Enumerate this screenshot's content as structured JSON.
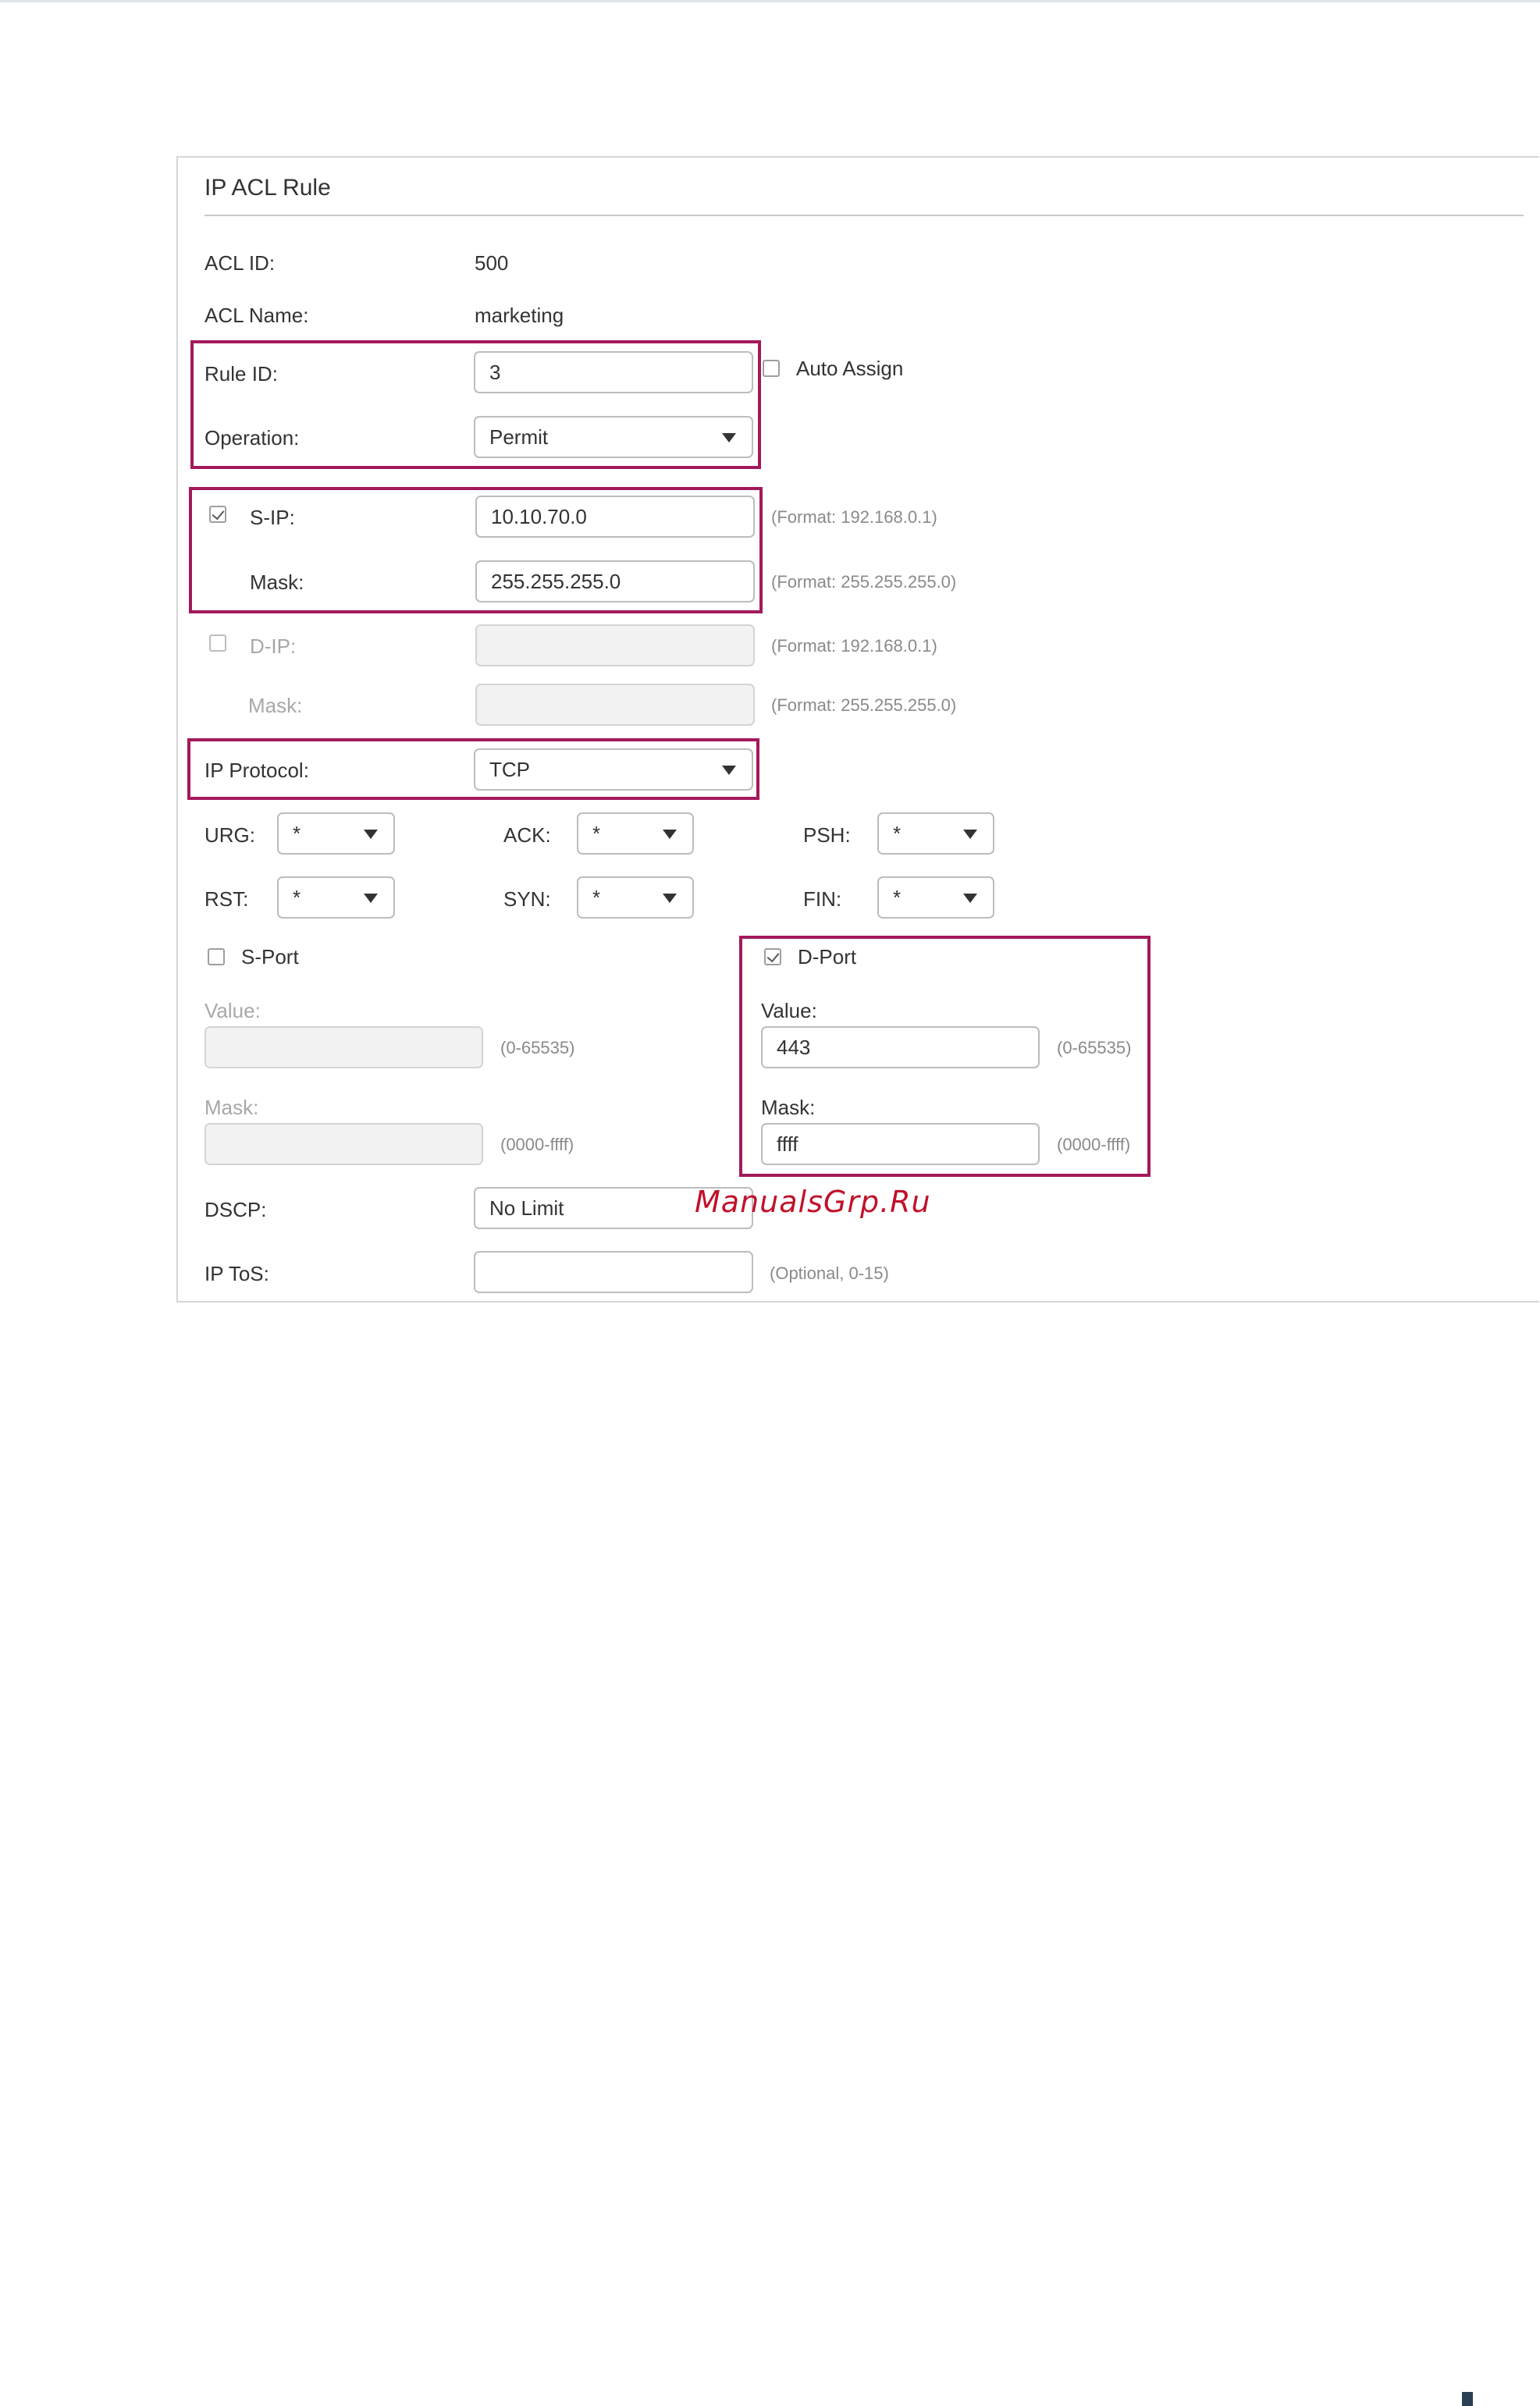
{
  "panel": {
    "title": "IP ACL Rule",
    "acl_id_label": "ACL ID:",
    "acl_id_value": "500",
    "acl_name_label": "ACL Name:",
    "acl_name_value": "marketing",
    "rule_id_label": "Rule ID:",
    "rule_id_value": "3",
    "auto_assign_label": "Auto Assign",
    "auto_assign_checked": false,
    "operation_label": "Operation:",
    "operation_value": "Permit",
    "sip_label": "S-IP:",
    "sip_checked": true,
    "sip_value": "10.10.70.0",
    "sip_hint": "(Format: 192.168.0.1)",
    "sip_mask_label": "Mask:",
    "sip_mask_value": "255.255.255.0",
    "sip_mask_hint": "(Format: 255.255.255.0)",
    "dip_label": "D-IP:",
    "dip_checked": false,
    "dip_value": "",
    "dip_hint": "(Format: 192.168.0.1)",
    "dip_mask_label": "Mask:",
    "dip_mask_value": "",
    "dip_mask_hint": "(Format: 255.255.255.0)",
    "ip_protocol_label": "IP Protocol:",
    "ip_protocol_value": "TCP",
    "flags": {
      "urg_label": "URG:",
      "urg_value": "*",
      "ack_label": "ACK:",
      "ack_value": "*",
      "psh_label": "PSH:",
      "psh_value": "*",
      "rst_label": "RST:",
      "rst_value": "*",
      "syn_label": "SYN:",
      "syn_value": "*",
      "fin_label": "FIN:",
      "fin_value": "*"
    },
    "sport": {
      "label": "S-Port",
      "checked": false,
      "value_label": "Value:",
      "value": "",
      "value_hint": "(0-65535)",
      "mask_label": "Mask:",
      "mask": "",
      "mask_hint": "(0000-ffff)"
    },
    "dport": {
      "label": "D-Port",
      "checked": true,
      "value_label": "Value:",
      "value": "443",
      "value_hint": "(0-65535)",
      "mask_label": "Mask:",
      "mask": "ffff",
      "mask_hint": "(0000-ffff)"
    },
    "dscp_label": "DSCP:",
    "dscp_value": "No Limit",
    "ip_tos_label": "IP ToS:",
    "ip_tos_value": "",
    "ip_tos_hint": "(Optional, 0-15)"
  },
  "watermark": "ManualsGrp.Ru",
  "colors": {
    "highlight": "#a3195b",
    "border": "#bdbdbd",
    "disabled_bg": "#f2f2f2",
    "hint": "#8a8a8a"
  }
}
